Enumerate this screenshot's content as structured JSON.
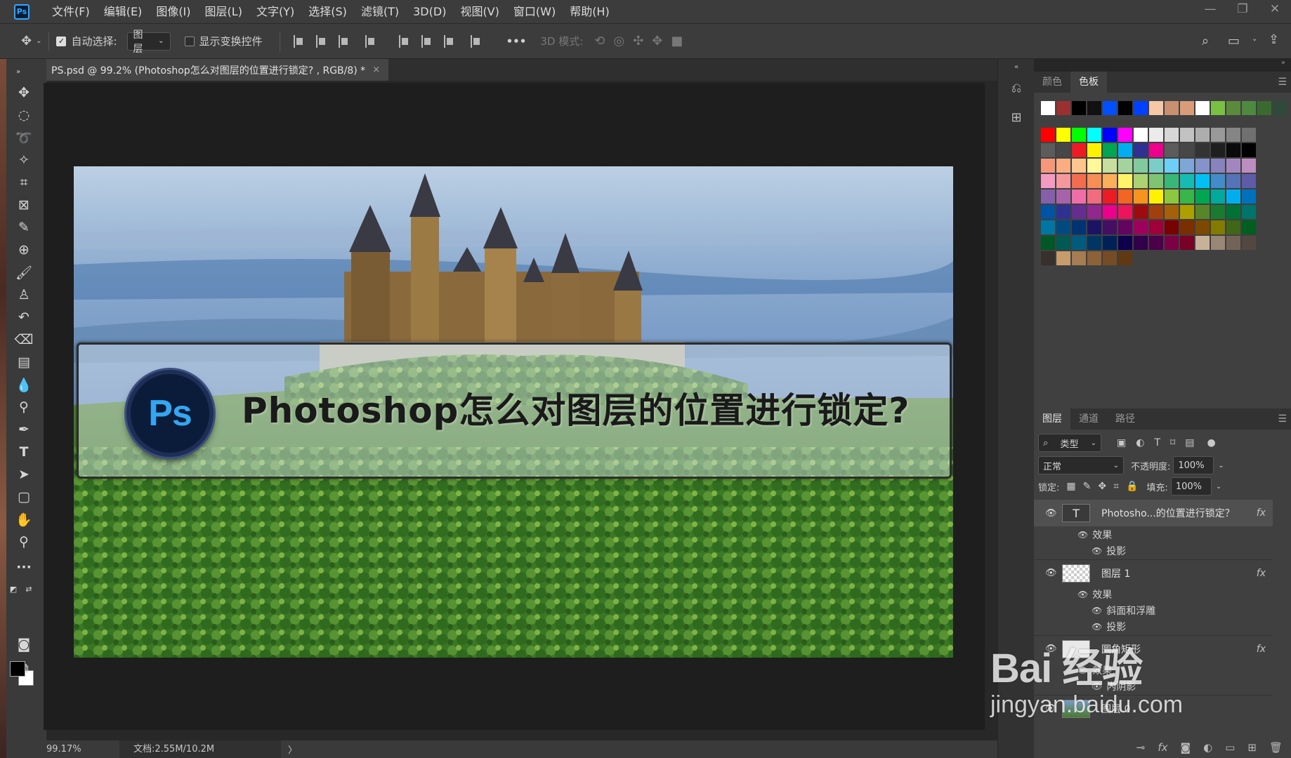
{
  "app": {
    "logo": "Ps"
  },
  "menu": [
    "文件(F)",
    "编辑(E)",
    "图像(I)",
    "图层(L)",
    "文字(Y)",
    "选择(S)",
    "滤镜(T)",
    "3D(D)",
    "视图(V)",
    "窗口(W)",
    "帮助(H)"
  ],
  "window_controls": {
    "minimize": "—",
    "restore": "❐",
    "close": "✕"
  },
  "options": {
    "auto_select_label": "自动选择:",
    "auto_select_checked": true,
    "auto_select_target": "图层",
    "show_transform_label": "显示变换控件",
    "show_transform_checked": false,
    "more": "•••",
    "mode_3d_label": "3D 模式:"
  },
  "document": {
    "tab_title": "PS.psd @ 99.2% (Photoshop怎么对图层的位置进行锁定? , RGB/8) *",
    "tab_close": "×",
    "banner_title": "Photoshop怎么对图层的位置进行锁定?",
    "badge_text": "Ps"
  },
  "status": {
    "zoom": "99.17%",
    "doc_size": "文档:2.55M/10.2M",
    "arrow": "〉"
  },
  "swatches": {
    "tabs": [
      "颜色",
      "色板"
    ],
    "active_tab": "色板",
    "recent": [
      "#ffffff",
      "#9b3030",
      "#000000",
      "#111111",
      "#0050ff",
      "#000000",
      "#0040ff",
      "#f5c8a8",
      "#c89070",
      "#d89c78",
      "#ffffff",
      "#7ac143",
      "#5a8a3a",
      "#4d8a40",
      "#3a6a30",
      "#2f4a3a"
    ],
    "grid": [
      "#ff0000",
      "#ffff00",
      "#00ff00",
      "#00ffff",
      "#0000ff",
      "#ff00ff",
      "#ffffff",
      "#ebebeb",
      "#d6d6d6",
      "#c2c2c2",
      "#adadad",
      "#999999",
      "#858585",
      "#707070",
      "#5c5c5c",
      "#474747",
      "#ed1c24",
      "#fff200",
      "#00a651",
      "#00aeef",
      "#2e3192",
      "#ec008c",
      "#5c5c5c",
      "#474747",
      "#333333",
      "#1f1f1f",
      "#0a0a0a",
      "#000000",
      "#f7977a",
      "#fbad82",
      "#fdc68c",
      "#fff799",
      "#c6df9c",
      "#a4d49d",
      "#81ca9d",
      "#7bcdc8",
      "#6ccff7",
      "#7ea7d8",
      "#8493ca",
      "#8882be",
      "#a187be",
      "#bc8dbf",
      "#f49bc1",
      "#f5989d",
      "#f26c4f",
      "#f68e55",
      "#fbaf5a",
      "#fff467",
      "#acd372",
      "#7dc473",
      "#39b778",
      "#16bcb4",
      "#00bff3",
      "#438ccb",
      "#5573b7",
      "#5e5ca7",
      "#855fa8",
      "#a763a9",
      "#ef6ea8",
      "#f16d7e",
      "#ed1c24",
      "#f26522",
      "#f7941d",
      "#fff200",
      "#8dc63f",
      "#39b54a",
      "#00a651",
      "#00a99d",
      "#00aeef",
      "#0072bc",
      "#0054a5",
      "#2e3192",
      "#662d91",
      "#92278f",
      "#ec008c",
      "#ed145b",
      "#9e0b0f",
      "#a0410d",
      "#a3620a",
      "#aba000",
      "#588528",
      "#197b30",
      "#007236",
      "#00736a",
      "#0076a4",
      "#004a80",
      "#003471",
      "#1b1464",
      "#440e62",
      "#630460",
      "#9e005d",
      "#9e0039",
      "#790000",
      "#7b2e00",
      "#7d4900",
      "#827b00",
      "#406618",
      "#005e20",
      "#005826",
      "#005952",
      "#005b7f",
      "#003663",
      "#002157",
      "#0d004c",
      "#32004b",
      "#4b0049",
      "#7b0046",
      "#7a0026",
      "#c7b299",
      "#998675",
      "#736357",
      "#534741",
      "#37302d",
      "#c69c6d",
      "#a67c52",
      "#8c6239",
      "#754c24",
      "#603913"
    ],
    "footer_icons": [
      "new-swatch",
      "delete"
    ]
  },
  "layers": {
    "tabs": [
      "图层",
      "通道",
      "路径"
    ],
    "active_tab": "图层",
    "filter_label": "类型",
    "blend_mode": "正常",
    "opacity_label": "不透明度:",
    "opacity": "100%",
    "lock_label": "锁定:",
    "fill_label": "填充:",
    "fill": "100%",
    "items": [
      {
        "name": "Photosho...的位置进行锁定？",
        "type": "text",
        "thumb": "T",
        "fx": "fx",
        "selected": true,
        "effects_label": "效果",
        "effects": [
          "投影"
        ]
      },
      {
        "name": "图层 1",
        "type": "raster",
        "fx": "fx",
        "selected": false,
        "effects_label": "效果",
        "effects": [
          "斜面和浮雕",
          "投影"
        ]
      },
      {
        "name": "圆角矩形",
        "type": "shape",
        "fx": "fx",
        "selected": false,
        "effects_label": "效果",
        "effects": [
          "内阴影"
        ]
      },
      {
        "name": "图层 0",
        "type": "image",
        "selected": false
      }
    ]
  },
  "watermark": {
    "brand": "Bai 经验",
    "url": "jingyan.baidu.com"
  }
}
